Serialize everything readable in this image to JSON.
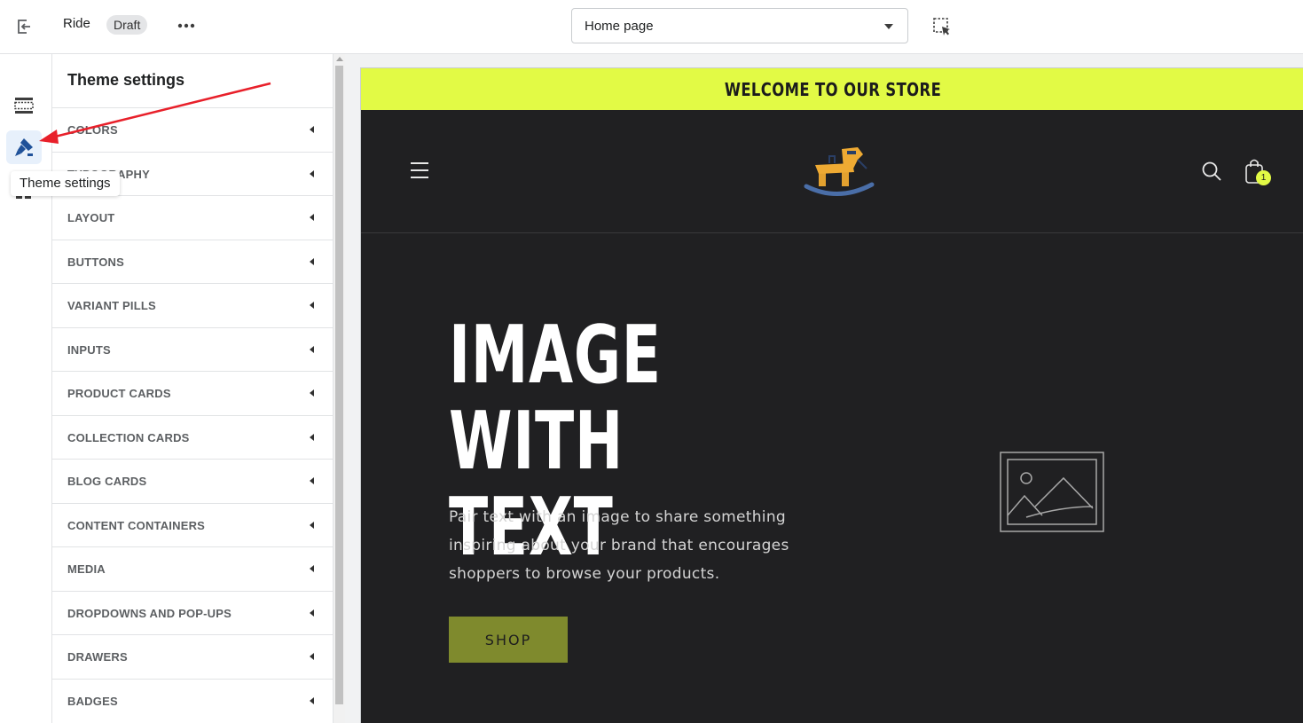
{
  "topbar": {
    "theme_name": "Ride",
    "status_badge": "Draft",
    "page_select": {
      "selected": "Home page"
    }
  },
  "rail": {
    "tooltip": "Theme settings",
    "active_item": "theme-settings"
  },
  "panel": {
    "title": "Theme settings",
    "items": [
      "COLORS",
      "TYPOGRAPHY",
      "LAYOUT",
      "BUTTONS",
      "VARIANT PILLS",
      "INPUTS",
      "PRODUCT CARDS",
      "COLLECTION CARDS",
      "BLOG CARDS",
      "CONTENT CONTAINERS",
      "MEDIA",
      "DROPDOWNS AND POP-UPS",
      "DRAWERS",
      "BADGES"
    ]
  },
  "preview": {
    "announcement": "WELCOME TO OUR STORE",
    "cart_count": "1",
    "hero": {
      "title_line1": "IMAGE WITH",
      "title_line2": "TEXT",
      "text": "Pair text with an image to share something inspiring about your brand that encourages shoppers to browse your products.",
      "button": "SHOP"
    }
  },
  "colors": {
    "announcement_bg": "#e2fa45",
    "store_bg": "#202022",
    "button_bg": "#7f8a2d",
    "annotation_arrow": "#e8202a",
    "rail_active_icon": "#1f5199"
  }
}
